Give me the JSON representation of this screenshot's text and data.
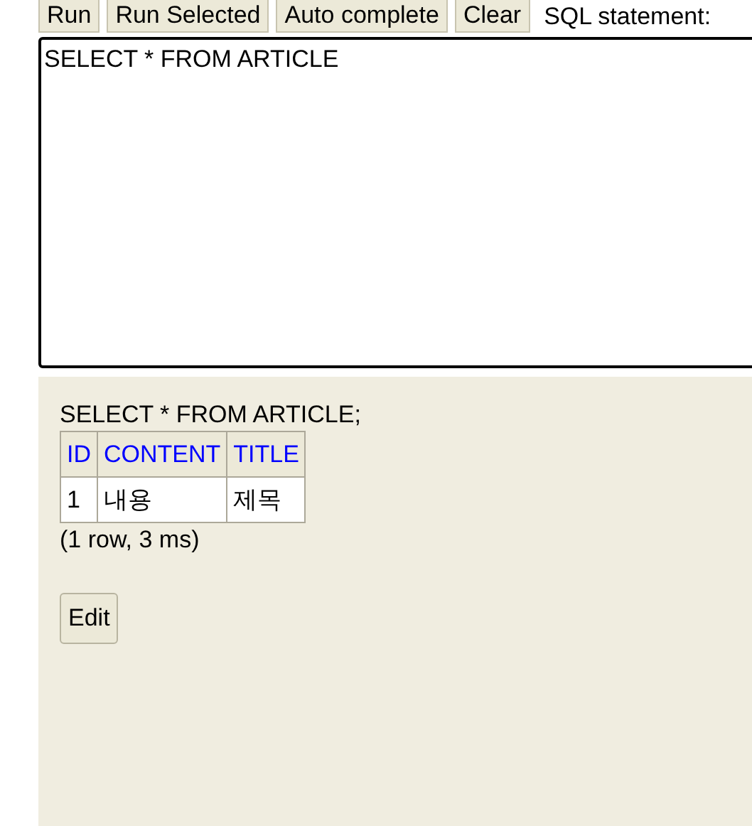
{
  "toolbar": {
    "buttons": [
      "Run",
      "Run Selected",
      "Auto complete",
      "Clear"
    ],
    "label": "SQL statement:"
  },
  "editor": {
    "value": "SELECT * FROM ARTICLE"
  },
  "result": {
    "statement": "SELECT * FROM ARTICLE;",
    "table": {
      "columns": [
        "ID",
        "CONTENT",
        "TITLE"
      ],
      "rows": [
        [
          "1",
          "내용",
          "제목"
        ]
      ]
    },
    "summary": "(1 row, 3 ms)",
    "buttons": [
      "Edit"
    ]
  }
}
